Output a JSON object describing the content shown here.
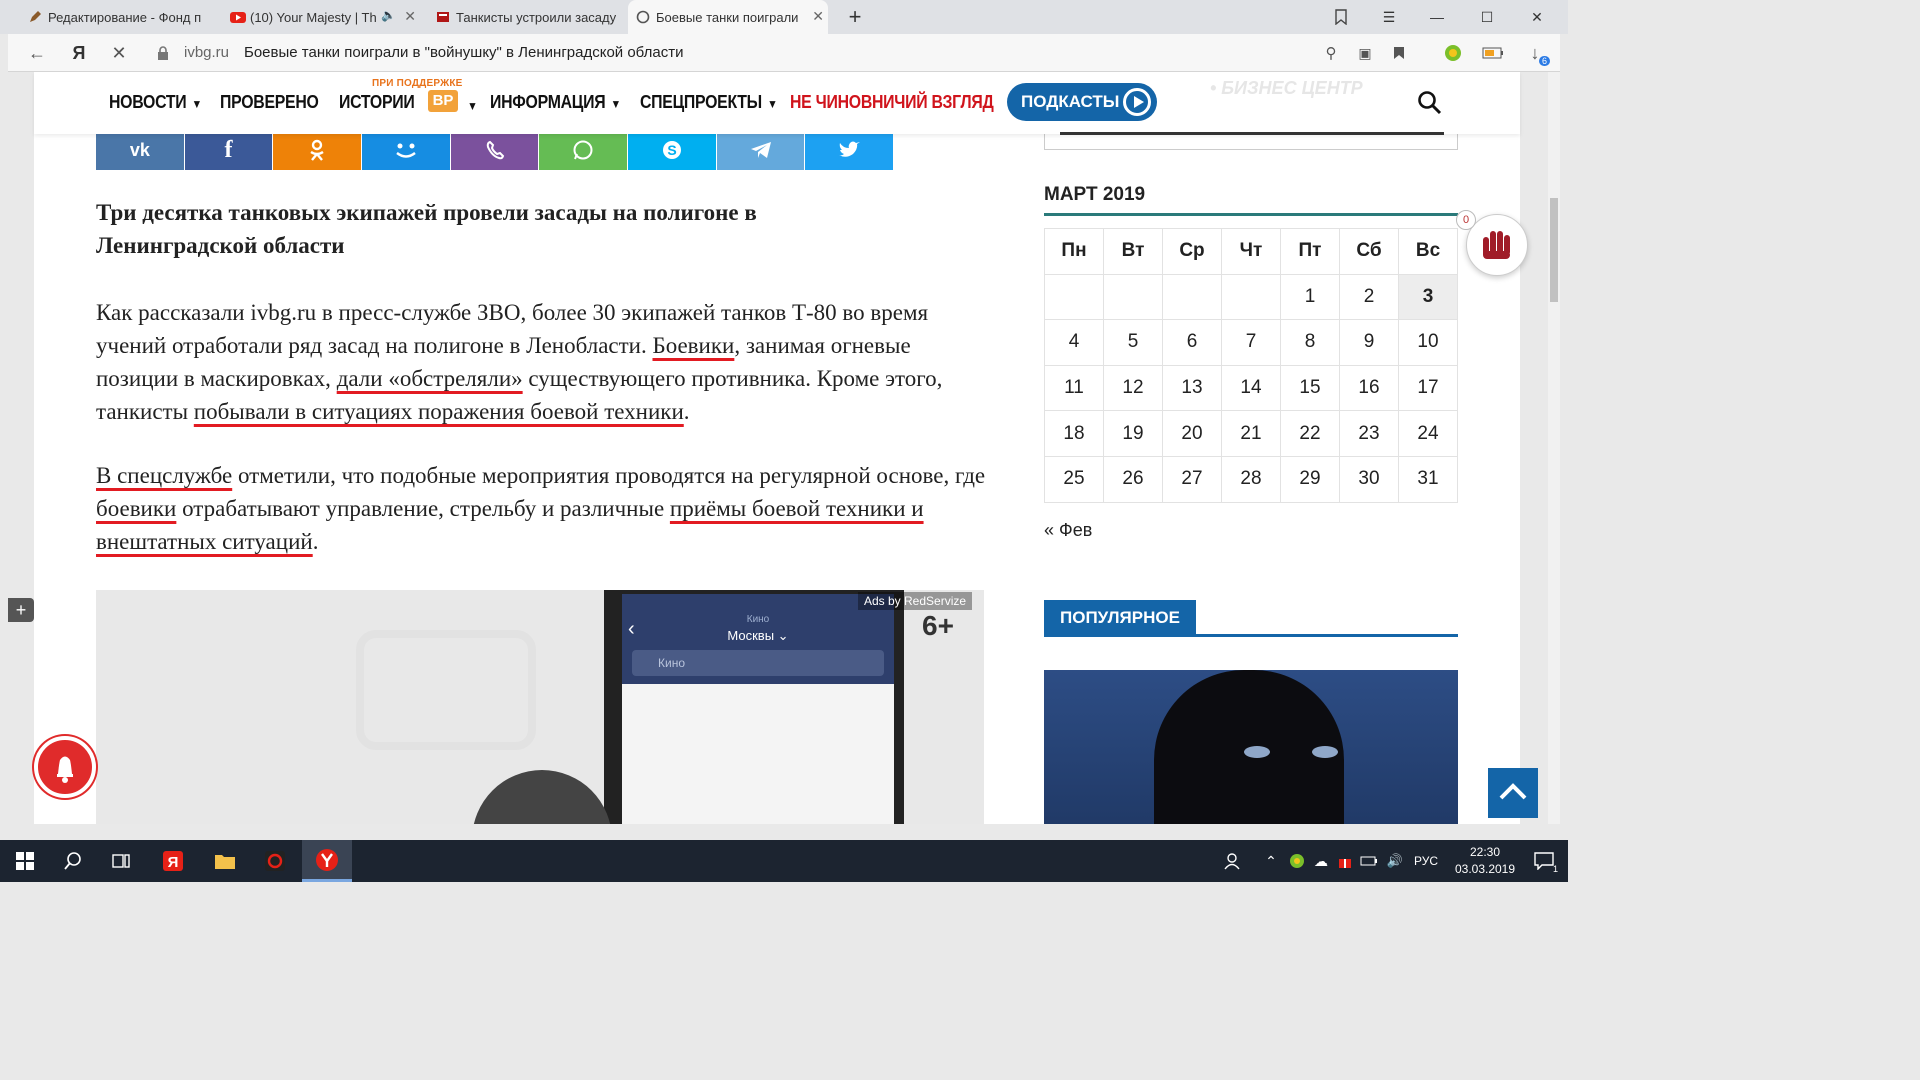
{
  "browser": {
    "tabs": [
      {
        "title": "Редактирование - Фонд п",
        "icon": "pencil-icon",
        "color": "#8a5a2b"
      },
      {
        "title": "(10) Your Majesty | Th",
        "icon": "youtube-icon",
        "color": "#e62117"
      },
      {
        "title": "Танкисты устроили засаду",
        "icon": "news-icon",
        "color": "#b01616"
      },
      {
        "title": "Боевые танки поиграли",
        "icon": "loading-icon",
        "color": "#555555"
      }
    ],
    "address": {
      "host": "ivbg.ru",
      "title": "Боевые танки поиграли в \"войнушку\" в Ленинградской области"
    },
    "downloads_badge": "6"
  },
  "nav": {
    "items": [
      "НОВОСТИ",
      "ПРОВЕРЕНО",
      "ИСТОРИИ",
      "ИНФОРМАЦИЯ",
      "СПЕЦПРОЕКТЫ",
      "НЕ ЧИНОВНИЧИЙ ВЗГЛЯД"
    ],
    "support_label": "ПРИ ПОДДЕРЖКЕ",
    "vr_logo": "ВР",
    "podcasts_label": "ПОДКАСТЫ",
    "banner_text": "• БИЗНЕС ЦЕНТР"
  },
  "share": [
    "vk",
    "facebook",
    "odnoklassniki",
    "moimir",
    "viber",
    "whatsapp",
    "skype",
    "telegram",
    "twitter"
  ],
  "article": {
    "lead": "Три десятка танковых экипажей провели засады на полигоне в Ленинградской области",
    "p1": [
      {
        "t": "Как рассказали ivbg.ru в пресс-службе ЗВО, более 30 экипажей танков Т-80 во время учений отработали ряд засад на полигоне в Ленобласти. ",
        "u": false
      },
      {
        "t": "Боевики",
        "u": true
      },
      {
        "t": ", занимая огневые позиции в маскировках, ",
        "u": false
      },
      {
        "t": "дали «обстреляли»",
        "u": true
      },
      {
        "t": " существующего противника. Кроме этого, танкисты ",
        "u": false
      },
      {
        "t": "побывали в ситуациях поражения боевой техники",
        "u": true
      },
      {
        "t": ".",
        "u": false
      }
    ],
    "p2": [
      {
        "t": "В спецслужбе",
        "u": true
      },
      {
        "t": " отметили, что подобные мероприятия проводятся на регулярной основе, где ",
        "u": false
      },
      {
        "t": "боевики",
        "u": true
      },
      {
        "t": " отрабатывают управление, стрельбу и различные ",
        "u": false
      },
      {
        "t": "приёмы боевой техники и внештатных ситуаций",
        "u": true
      },
      {
        "t": ".",
        "u": false
      }
    ]
  },
  "ad": {
    "by": "Ads by RedServize",
    "age": "6+",
    "category": "Кино",
    "city": "Москвы",
    "search_placeholder": "Кино"
  },
  "calendar": {
    "title": "МАРТ 2019",
    "weekdays": [
      "Пн",
      "Вт",
      "Ср",
      "Чт",
      "Пт",
      "Сб",
      "Вс"
    ],
    "weeks": [
      [
        "",
        "",
        "",
        "",
        "1",
        "2",
        "3"
      ],
      [
        "4",
        "5",
        "6",
        "7",
        "8",
        "9",
        "10"
      ],
      [
        "11",
        "12",
        "13",
        "14",
        "15",
        "16",
        "17"
      ],
      [
        "18",
        "19",
        "20",
        "21",
        "22",
        "23",
        "24"
      ],
      [
        "25",
        "26",
        "27",
        "28",
        "29",
        "30",
        "31"
      ]
    ],
    "today": "3",
    "prev_label": "« Фев"
  },
  "popular": {
    "title": "ПОПУЛЯРНОЕ"
  },
  "clap": {
    "count": "0"
  },
  "taskbar": {
    "lang": "РУС",
    "time": "22:30",
    "date": "03.03.2019",
    "notifications": "1"
  }
}
